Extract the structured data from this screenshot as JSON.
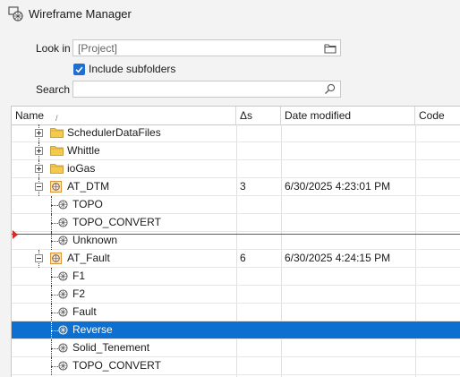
{
  "window": {
    "title": "Wireframe Manager",
    "icon": "wireframe-manager-icon"
  },
  "form": {
    "look_in_label": "Look in",
    "look_in_value": "[Project]",
    "include_subfolders_label": "Include subfolders",
    "include_subfolders_checked": true,
    "search_label": "Search",
    "search_value": ""
  },
  "table": {
    "columns": [
      "Name",
      "Δs",
      "Date modified",
      "Code"
    ],
    "sort_indicator": "/",
    "rows": [
      {
        "name": "SchedulerDataFiles",
        "type": "folder",
        "expander": "plus",
        "ds": "",
        "date": "",
        "code": ""
      },
      {
        "name": "Whittle",
        "type": "folder",
        "expander": "plus",
        "ds": "",
        "date": "",
        "code": ""
      },
      {
        "name": "ioGas",
        "type": "folder",
        "expander": "plus",
        "ds": "",
        "date": "",
        "code": ""
      },
      {
        "name": "AT_DTM",
        "type": "wireframe-set",
        "expander": "minus",
        "ds": "3",
        "date": "6/30/2025 4:23:01 PM",
        "code": ""
      },
      {
        "name": "TOPO",
        "type": "wireframe",
        "ds": "",
        "date": "",
        "code": ""
      },
      {
        "name": "TOPO_CONVERT",
        "type": "wireframe",
        "ds": "",
        "date": "",
        "code": ""
      },
      {
        "name": "Unknown",
        "type": "wireframe",
        "ds": "",
        "date": "",
        "code": ""
      },
      {
        "name": "AT_Fault",
        "type": "wireframe-set",
        "expander": "minus",
        "ds": "6",
        "date": "6/30/2025 4:24:15 PM",
        "code": ""
      },
      {
        "name": "F1",
        "type": "wireframe",
        "ds": "",
        "date": "",
        "code": ""
      },
      {
        "name": "F2",
        "type": "wireframe",
        "ds": "",
        "date": "",
        "code": ""
      },
      {
        "name": "Fault",
        "type": "wireframe",
        "ds": "",
        "date": "",
        "code": ""
      },
      {
        "name": "Reverse",
        "type": "wireframe",
        "selected": true,
        "ds": "",
        "date": "",
        "code": ""
      },
      {
        "name": "Solid_Tenement",
        "type": "wireframe",
        "ds": "",
        "date": "",
        "code": ""
      },
      {
        "name": "TOPO_CONVERT",
        "type": "wireframe",
        "ds": "",
        "date": "",
        "code": ""
      }
    ]
  },
  "colors": {
    "selection": "#0d6fd0",
    "accent": "#1e6fd0",
    "drop_marker": "#d62828"
  }
}
